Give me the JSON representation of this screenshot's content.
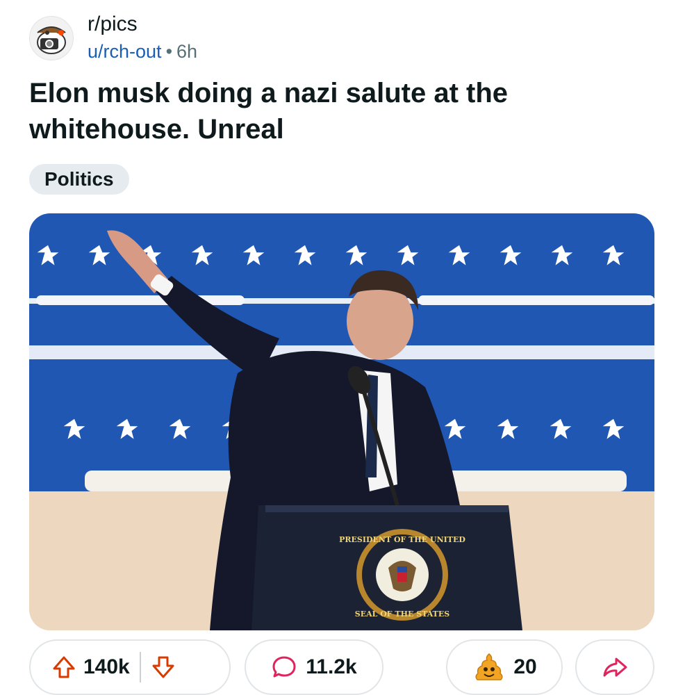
{
  "post": {
    "subreddit": "r/pics",
    "author": "u/rch-out",
    "separator": "•",
    "age": "6h",
    "title": "Elon musk doing a nazi salute at the whitehouse. Unreal",
    "flair": "Politics"
  },
  "image": {
    "seal_text_top": "PRESIDENT OF THE UNITED",
    "seal_text_bottom": "SEAL OF THE STATES"
  },
  "actions": {
    "upvotes": "140k",
    "comments": "11.2k",
    "awards": "20",
    "icons": {
      "upvote": "upvote-arrow-icon",
      "downvote": "downvote-arrow-icon",
      "comment": "comment-bubble-icon",
      "award": "poop-award-icon",
      "share": "share-arrow-icon"
    }
  },
  "colors": {
    "accent_red": "#d93a00",
    "link_blue": "#1a5fb4",
    "flair_bg": "#e5ebee",
    "stage_blue": "#1f57b3",
    "comment_icon_pink": "#e0245e"
  }
}
